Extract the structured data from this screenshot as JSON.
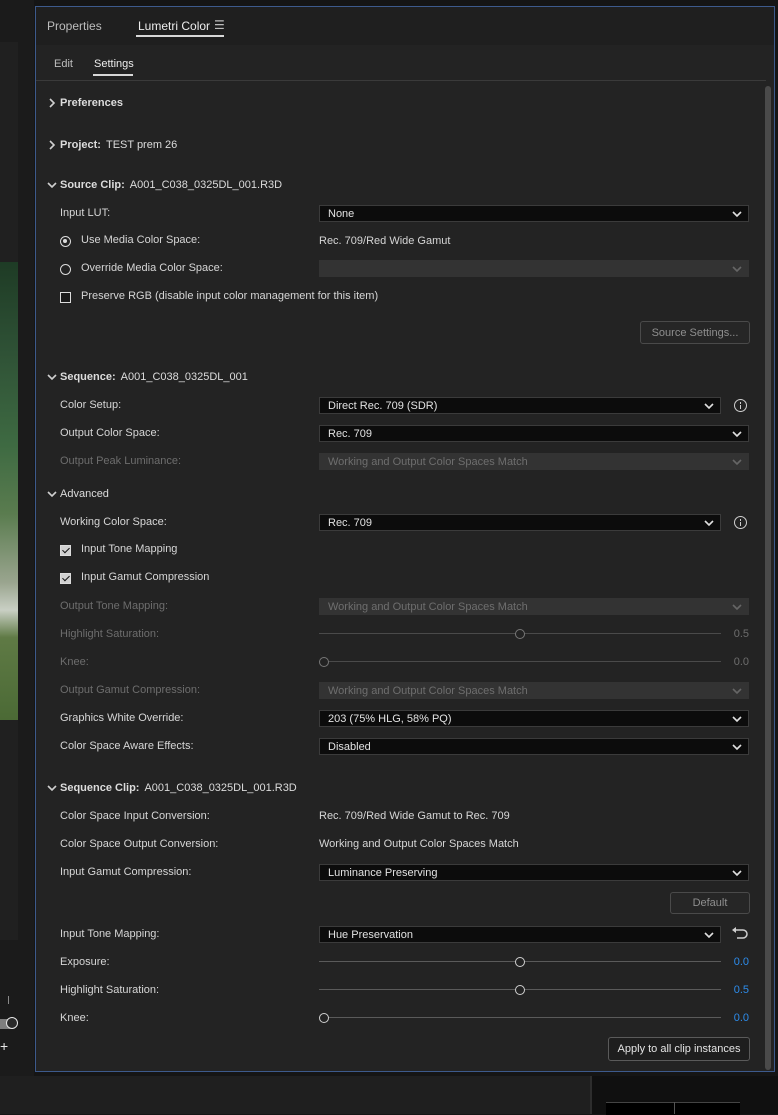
{
  "panel": {
    "tabs": [
      "Properties",
      "Lumetri Color"
    ],
    "menu_icon": "hamburger-menu-icon",
    "subtabs": [
      "Edit",
      "Settings"
    ]
  },
  "preferences": {
    "title": "Preferences"
  },
  "project": {
    "title": "Project:",
    "value": "TEST prem 26"
  },
  "source_clip": {
    "title": "Source Clip:",
    "value": "A001_C038_0325DL_001.R3D",
    "input_lut_label": "Input LUT:",
    "input_lut_value": "None",
    "use_media_label": "Use Media Color Space:",
    "use_media_value": "Rec. 709/Red Wide Gamut",
    "override_label": "Override Media Color Space:",
    "override_value": "",
    "preserve_rgb_label": "Preserve RGB (disable input color management for this item)",
    "source_settings_button": "Source Settings..."
  },
  "sequence": {
    "title": "Sequence:",
    "value": "A001_C038_0325DL_001",
    "color_setup_label": "Color Setup:",
    "color_setup_value": "Direct Rec. 709 (SDR)",
    "output_space_label": "Output Color Space:",
    "output_space_value": "Rec. 709",
    "peak_label": "Output Peak Luminance:",
    "peak_value": "Working and Output Color Spaces Match"
  },
  "advanced": {
    "title": "Advanced",
    "working_label": "Working Color Space:",
    "working_value": "Rec. 709",
    "tone_mapping_label": "Input Tone Mapping",
    "gamut_compression_label": "Input Gamut Compression",
    "output_tone_label": "Output Tone Mapping:",
    "output_tone_value": "Working and Output Color Spaces Match",
    "highlight_label": "Highlight Saturation:",
    "highlight_value": "0.5",
    "knee_label": "Knee:",
    "knee_value": "0.0",
    "output_gamut_label": "Output Gamut Compression:",
    "output_gamut_value": "Working and Output Color Spaces Match",
    "white_override_label": "Graphics White Override:",
    "white_override_value": "203 (75% HLG, 58% PQ)",
    "aware_effects_label": "Color Space Aware Effects:",
    "aware_effects_value": "Disabled"
  },
  "sequence_clip": {
    "title": "Sequence Clip:",
    "value": "A001_C038_0325DL_001.R3D",
    "input_conv_label": "Color Space Input Conversion:",
    "input_conv_value": "Rec. 709/Red Wide Gamut to Rec. 709",
    "output_conv_label": "Color Space Output Conversion:",
    "output_conv_value": "Working and Output Color Spaces Match",
    "gamut_label": "Input Gamut Compression:",
    "gamut_value": "Luminance Preserving",
    "default_button": "Default",
    "tone_label": "Input Tone Mapping:",
    "tone_value": "Hue Preservation",
    "exposure_label": "Exposure:",
    "exposure_value": "0.0",
    "highlight_label": "Highlight Saturation:",
    "highlight_value": "0.5",
    "knee_label": "Knee:",
    "knee_value": "0.0",
    "apply_button": "Apply to all clip instances"
  },
  "sliders": {
    "adv_highlight": 0.5,
    "adv_knee": 0.0,
    "clip_exposure": 0.5,
    "clip_highlight": 0.5,
    "clip_knee": 0.0
  },
  "state": {
    "use_media_selected": true,
    "override_selected": false,
    "preserve_rgb_checked": false,
    "input_tone_mapping_checked": true,
    "input_gamut_compression_checked": true
  },
  "colors": {
    "accent_value": "#2d8ceb",
    "panel_border": "#3d5a8c"
  }
}
